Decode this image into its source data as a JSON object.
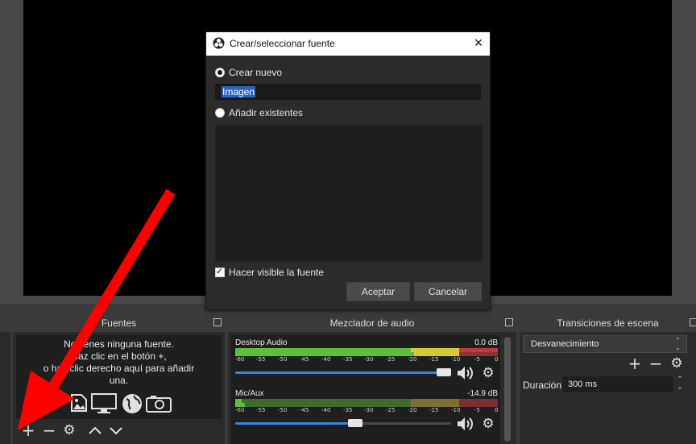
{
  "dialog": {
    "title": "Crear/seleccionar fuente",
    "create_new_label": "Crear nuevo",
    "name_value": "Imagen",
    "add_existing_label": "Añadir existentes",
    "visible_label": "Hacer visible la fuente",
    "accept_label": "Aceptar",
    "cancel_label": "Cancelar"
  },
  "sources": {
    "title": "Fuentes",
    "empty_line1": "No tienes ninguna fuente.",
    "empty_line2": "Haz clic en el botón +,",
    "empty_line3": "o haz clic derecho aquí para añadir",
    "empty_line4": "una.",
    "icons": [
      "image-icon",
      "display-icon",
      "globe-icon",
      "camera-icon"
    ]
  },
  "mixer": {
    "title": "Mezclador de audio",
    "channels": [
      {
        "name": "Desktop Audio",
        "db": "0.0 dB",
        "volume": 1.0
      },
      {
        "name": "Mic/Aux",
        "db": "-14.9 dB",
        "volume": 0.55
      }
    ],
    "scale": [
      "-60",
      "-55",
      "-50",
      "-45",
      "-40",
      "-35",
      "-30",
      "-25",
      "-20",
      "-15",
      "-10",
      "-5",
      "0"
    ]
  },
  "transitions": {
    "title": "Transiciones de escena",
    "selected": "Desvanecimiento",
    "duration_label": "Duración",
    "duration_value": "300 ms"
  },
  "colors": {
    "meter_green": "#5fbf3a",
    "meter_yellow": "#d8c93a",
    "meter_red": "#c43a3a",
    "slider_blue": "#3a85d8",
    "arrow_red": "#ff0000"
  }
}
